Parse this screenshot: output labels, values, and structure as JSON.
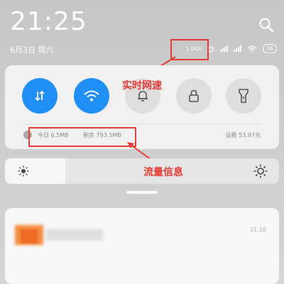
{
  "status": {
    "time": "21:25",
    "date": "6月3日 周六",
    "speed": "1.0K/s",
    "battery": "56"
  },
  "quick_toggles": [
    {
      "name": "data",
      "state": "on"
    },
    {
      "name": "wifi",
      "state": "on"
    },
    {
      "name": "bell",
      "state": "off"
    },
    {
      "name": "lock",
      "state": "off"
    },
    {
      "name": "flashlight",
      "state": "off"
    }
  ],
  "data_usage": {
    "today": "今日 6.5MB",
    "remaining": "剩余 793.5MB",
    "balance": "话费 53.97元"
  },
  "annotations": {
    "speed_label": "实时网速",
    "data_label": "流量信息"
  },
  "notification": {
    "time": "21:10"
  },
  "colors": {
    "accent": "#1f8ef5",
    "annotation": "#e43d35"
  }
}
